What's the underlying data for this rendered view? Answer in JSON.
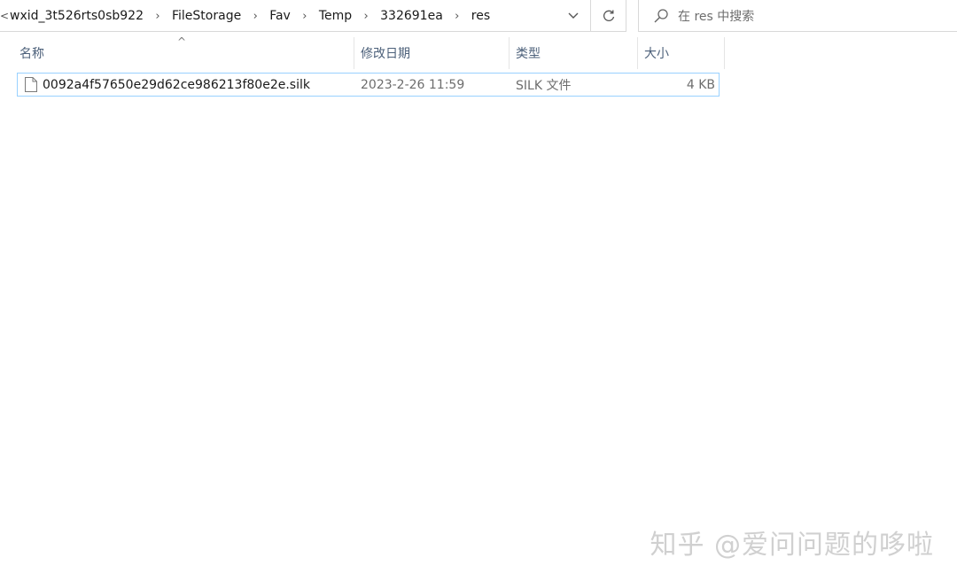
{
  "address_bar": {
    "lead_glyph": "<",
    "breadcrumbs": [
      "wxid_3t526rts0sb922",
      "FileStorage",
      "Fav",
      "Temp",
      "332691ea",
      "res"
    ],
    "separator": "›"
  },
  "search": {
    "placeholder": "在 res 中搜索"
  },
  "columns": {
    "name": "名称",
    "date": "修改日期",
    "type": "类型",
    "size": "大小"
  },
  "sort_indicator": "^",
  "files": [
    {
      "name": "0092a4f57650e29d62ce986213f80e2e.silk",
      "modified": "2023-2-26 11:59",
      "type": "SILK 文件",
      "size": "4 KB"
    }
  ],
  "watermark": "知乎 @爱问问题的哆啦",
  "colors": {
    "selection_border": "#99d1ff",
    "header_text": "#4c607a",
    "muted_text": "#6d6d6d"
  },
  "icons": {
    "dropdown": "chevron-down-icon",
    "refresh": "refresh-icon",
    "search": "search-icon",
    "file": "file-icon"
  }
}
